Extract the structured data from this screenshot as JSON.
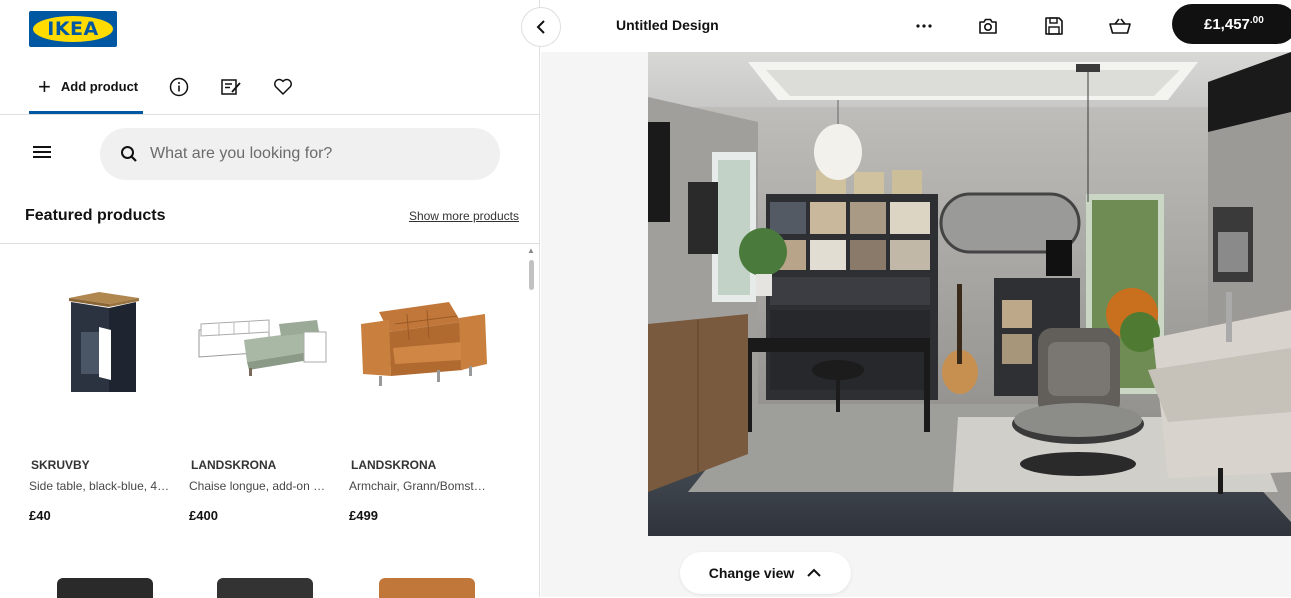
{
  "logo": {
    "text": "IKEA"
  },
  "tabs": {
    "add_product": "Add product"
  },
  "search": {
    "placeholder": "What are you looking for?"
  },
  "featured": {
    "title": "Featured products",
    "show_more": "Show more products",
    "products": [
      {
        "brand": "SKRUVBY",
        "desc": "Side table, black-blue, 4…",
        "price": "£40"
      },
      {
        "brand": "LANDSKRONA",
        "desc": "Chaise longue, add-on …",
        "price": "£400"
      },
      {
        "brand": "LANDSKRONA",
        "desc": "Armchair, Grann/Bomst…",
        "price": "£499"
      }
    ]
  },
  "topbar": {
    "title": "Untitled Design",
    "total_main": "£1,457",
    "total_decimal": ".00"
  },
  "canvas": {
    "change_view": "Change view"
  },
  "colors": {
    "brand_blue": "#0058a3",
    "brand_yellow": "#ffdb00",
    "accent": "#111111"
  }
}
